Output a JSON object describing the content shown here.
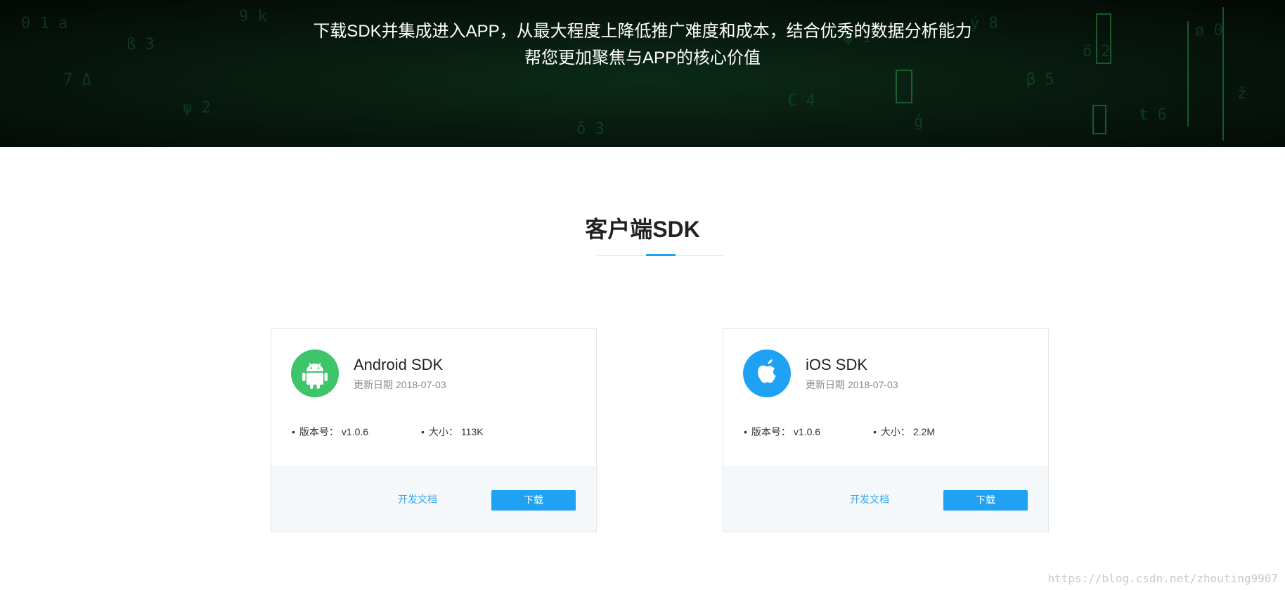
{
  "hero": {
    "line1": "下载SDK并集成进入APP，从最大程度上降低推广难度和成本，结合优秀的数据分析能力",
    "line2": "帮您更加聚焦与APP的核心价值"
  },
  "section": {
    "title": "客户端SDK"
  },
  "cards": [
    {
      "icon": "android-icon",
      "icon_color": "#3ec56a",
      "name": "Android SDK",
      "date_label": "更新日期",
      "date": "2018-07-03",
      "version_label": "版本号：",
      "version": "v1.0.6",
      "size_label": "大小：",
      "size": "113K",
      "doc_label": "开发文档",
      "download_label": "下载"
    },
    {
      "icon": "apple-icon",
      "icon_color": "#1fa2f3",
      "name": "iOS SDK",
      "date_label": "更新日期",
      "date": "2018-07-03",
      "version_label": "版本号：",
      "version": "v1.0.6",
      "size_label": "大小：",
      "size": "2.2M",
      "doc_label": "开发文档",
      "download_label": "下载"
    }
  ],
  "colors": {
    "accent": "#1fa2f3",
    "link": "#3aa3e3",
    "hero_bg": "#06110b",
    "footer_bg": "#f4f8fb"
  },
  "watermark": "https://blog.csdn.net/zhouting9907"
}
